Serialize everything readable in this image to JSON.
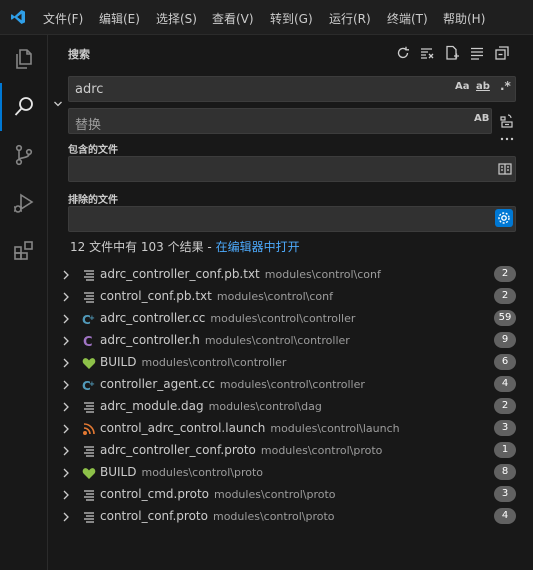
{
  "menu": [
    "文件(F)",
    "编辑(E)",
    "选择(S)",
    "查看(V)",
    "转到(G)",
    "运行(R)",
    "终端(T)",
    "帮助(H)"
  ],
  "search_panel": {
    "title": "搜索",
    "query": "adrc",
    "replace_placeholder": "替换",
    "match_case_label": "Aa",
    "whole_word_label": "ab",
    "regex_label": ".*",
    "preserve_case_label": "AB",
    "include_label": "包含的文件",
    "exclude_label": "排除的文件",
    "summary_text": "12 文件中有 103 个结果 - ",
    "open_in_editor": "在编辑器中打开"
  },
  "results": [
    {
      "name": "adrc_controller_conf.pb.txt",
      "path": "modules\\control\\conf",
      "count": "2",
      "icon": "text-file-icon"
    },
    {
      "name": "control_conf.pb.txt",
      "path": "modules\\control\\conf",
      "count": "2",
      "icon": "text-file-icon"
    },
    {
      "name": "adrc_controller.cc",
      "path": "modules\\control\\controller",
      "count": "59",
      "icon": "cpp-file-icon"
    },
    {
      "name": "adrc_controller.h",
      "path": "modules\\control\\controller",
      "count": "9",
      "icon": "c-header-file-icon"
    },
    {
      "name": "BUILD",
      "path": "modules\\control\\controller",
      "count": "6",
      "icon": "bazel-build-icon"
    },
    {
      "name": "controller_agent.cc",
      "path": "modules\\control\\controller",
      "count": "4",
      "icon": "cpp-file-icon"
    },
    {
      "name": "adrc_module.dag",
      "path": "modules\\control\\dag",
      "count": "2",
      "icon": "text-file-icon"
    },
    {
      "name": "control_adrc_control.launch",
      "path": "modules\\control\\launch",
      "count": "3",
      "icon": "rss-file-icon"
    },
    {
      "name": "adrc_controller_conf.proto",
      "path": "modules\\control\\proto",
      "count": "1",
      "icon": "text-file-icon"
    },
    {
      "name": "BUILD",
      "path": "modules\\control\\proto",
      "count": "8",
      "icon": "bazel-build-icon"
    },
    {
      "name": "control_cmd.proto",
      "path": "modules\\control\\proto",
      "count": "3",
      "icon": "text-file-icon"
    },
    {
      "name": "control_conf.proto",
      "path": "modules\\control\\proto",
      "count": "4",
      "icon": "text-file-icon"
    }
  ],
  "colors": {
    "accent": "#0078d4",
    "link": "#4daafc",
    "cpp": "#519aba",
    "c_header": "#a074c4",
    "bazel": "#8dc149",
    "rss": "#e37933"
  }
}
